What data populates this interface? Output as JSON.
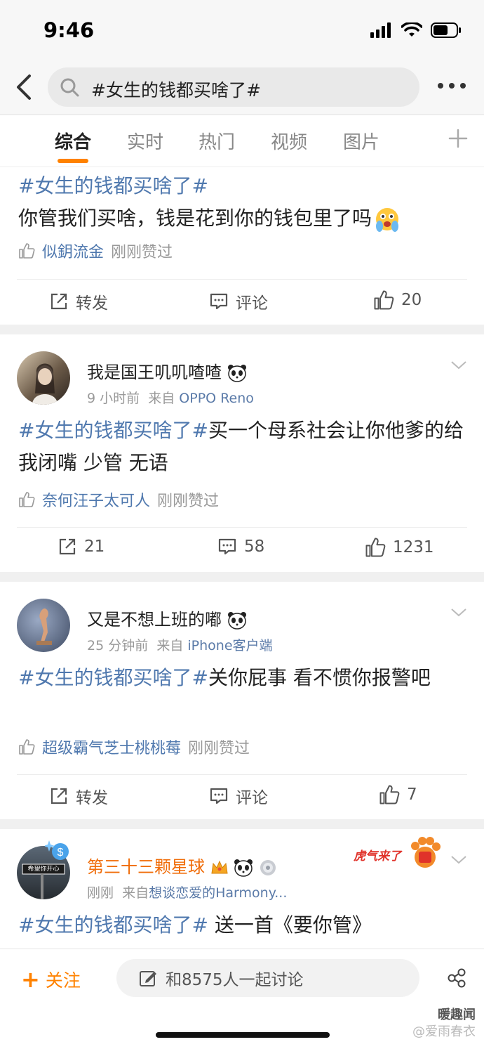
{
  "status": {
    "time": "9:46"
  },
  "search": {
    "query": "#女生的钱都买啥了#"
  },
  "tabs": [
    {
      "label": "综合"
    },
    {
      "label": "实时"
    },
    {
      "label": "热门"
    },
    {
      "label": "视频"
    },
    {
      "label": "图片"
    }
  ],
  "posts": [
    {
      "tag": "#女生的钱都买啥了#",
      "text": "你管我们买啥，钱是花到你的钱包里了吗",
      "liker": "似鈅流金",
      "liked_suffix": "刚刚赞过",
      "repost": "转发",
      "comment": "评论",
      "like": "20"
    },
    {
      "username": "我是国王叽叽喳喳",
      "time": "9 小时前",
      "from": "来自",
      "source": "OPPO Reno",
      "tag": "#女生的钱都买啥了#",
      "text": "买一个母系社会让你他爹的给我闭嘴 少管 无语",
      "liker": "奈何汪子太可人",
      "liked_suffix": "刚刚赞过",
      "repost": "21",
      "comment": "58",
      "like": "1231"
    },
    {
      "username": "又是不想上班的嘟",
      "time": "25 分钟前",
      "from": "来自",
      "source": "iPhone客户端",
      "tag": "#女生的钱都买啥了#",
      "text": "关你屁事  看不惯你报警吧",
      "liker": "超级霸气芝士桃桃莓",
      "liked_suffix": "刚刚赞过",
      "repost": "转发",
      "comment": "评论",
      "like": "7"
    },
    {
      "username": "第三十三颗星球",
      "time": "刚刚",
      "from": "来自",
      "source": "想谈恋爱的Harmony...",
      "avatar_sign": "希望你开心",
      "badge": "虎气来了",
      "tag": "#女生的钱都买啥了#",
      "text": " 送一首《要你管》"
    }
  ],
  "bottom": {
    "follow": "关注",
    "discuss": "和8575人一起讨论"
  },
  "watermark": {
    "line1": "暖趣闻",
    "line2": "@爱雨春衣"
  },
  "colors": {
    "accent": "#ff8200",
    "link": "#4f78ae",
    "vip_name": "#f06d0a"
  }
}
